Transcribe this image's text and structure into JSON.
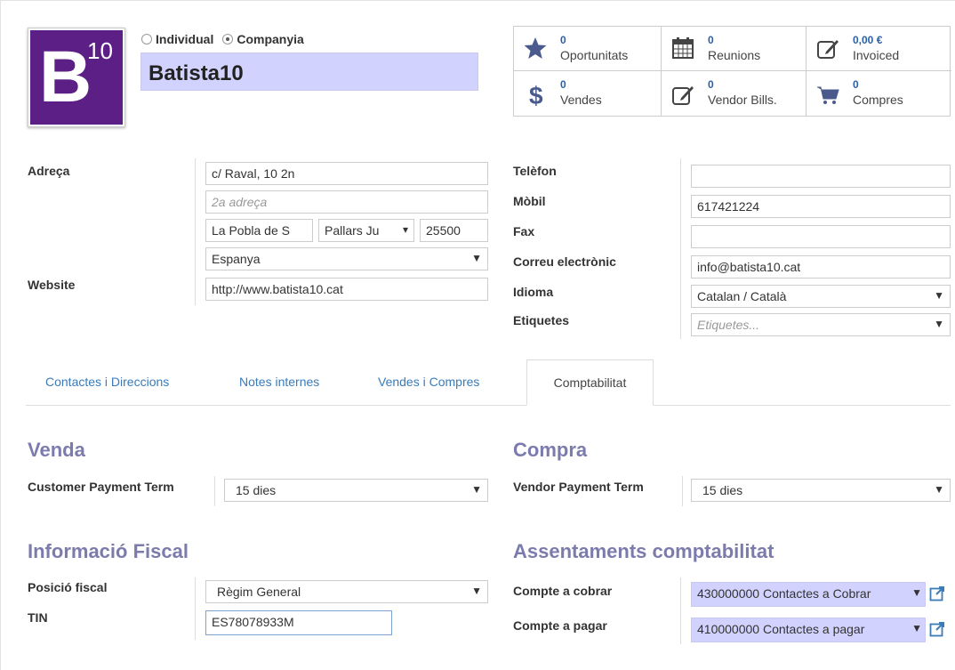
{
  "company": {
    "type_individual": "Individual",
    "type_company": "Companyia",
    "name": "Batista10",
    "avatar_letter": "B",
    "avatar_sup": "10"
  },
  "stats": [
    {
      "value": "0",
      "label": "Oportunitats",
      "icon": "star-icon"
    },
    {
      "value": "0",
      "label": "Reunions",
      "icon": "calendar-icon"
    },
    {
      "value": "0,00 €",
      "label": "Invoiced",
      "icon": "pencil-square-icon"
    },
    {
      "value": "0",
      "label": "Vendes",
      "icon": "dollar-icon"
    },
    {
      "value": "0",
      "label": "Vendor Bills.",
      "icon": "pencil-square-icon"
    },
    {
      "value": "0",
      "label": "Compres",
      "icon": "cart-icon"
    }
  ],
  "address": {
    "label": "Adreça",
    "street": "c/ Raval, 10 2n",
    "street2_placeholder": "2a adreça",
    "city": "La Pobla de S",
    "state": "Pallars Ju",
    "zip": "25500",
    "country": "Espanya"
  },
  "website": {
    "label": "Website",
    "value": "http://www.batista10.cat"
  },
  "contact": {
    "phone_label": "Telèfon",
    "phone": "",
    "mobile_label": "Mòbil",
    "mobile": "617421224",
    "fax_label": "Fax",
    "fax": "",
    "email_label": "Correu electrònic",
    "email": "info@batista10.cat",
    "lang_label": "Idioma",
    "lang": "Catalan / Català",
    "tags_label": "Etiquetes",
    "tags_placeholder": "Etiquetes..."
  },
  "tabs": [
    {
      "label": "Contactes i Direccions"
    },
    {
      "label": "Notes internes"
    },
    {
      "label": "Vendes i Compres"
    },
    {
      "label": "Comptabilitat"
    }
  ],
  "accounting": {
    "sale_title": "Venda",
    "customer_term_label": "Customer Payment Term",
    "customer_term": "15 dies",
    "purchase_title": "Compra",
    "vendor_term_label": "Vendor Payment Term",
    "vendor_term": "15 dies",
    "fiscal_title": "Informació Fiscal",
    "fiscal_pos_label": "Posició fiscal",
    "fiscal_pos": "Règim General",
    "tin_label": "TIN",
    "tin": "ES78078933M",
    "entries_title": "Assentaments comptabilitat",
    "receivable_label": "Compte a cobrar",
    "receivable": "430000000 Contactes a Cobrar",
    "payable_label": "Compte a pagar",
    "payable": "410000000 Contactes a pagar"
  },
  "colors": {
    "accent": "#7c7bad",
    "avatar_bg": "#5c1f86",
    "highlight": "#d2d2ff",
    "link": "#3a7bb8"
  }
}
